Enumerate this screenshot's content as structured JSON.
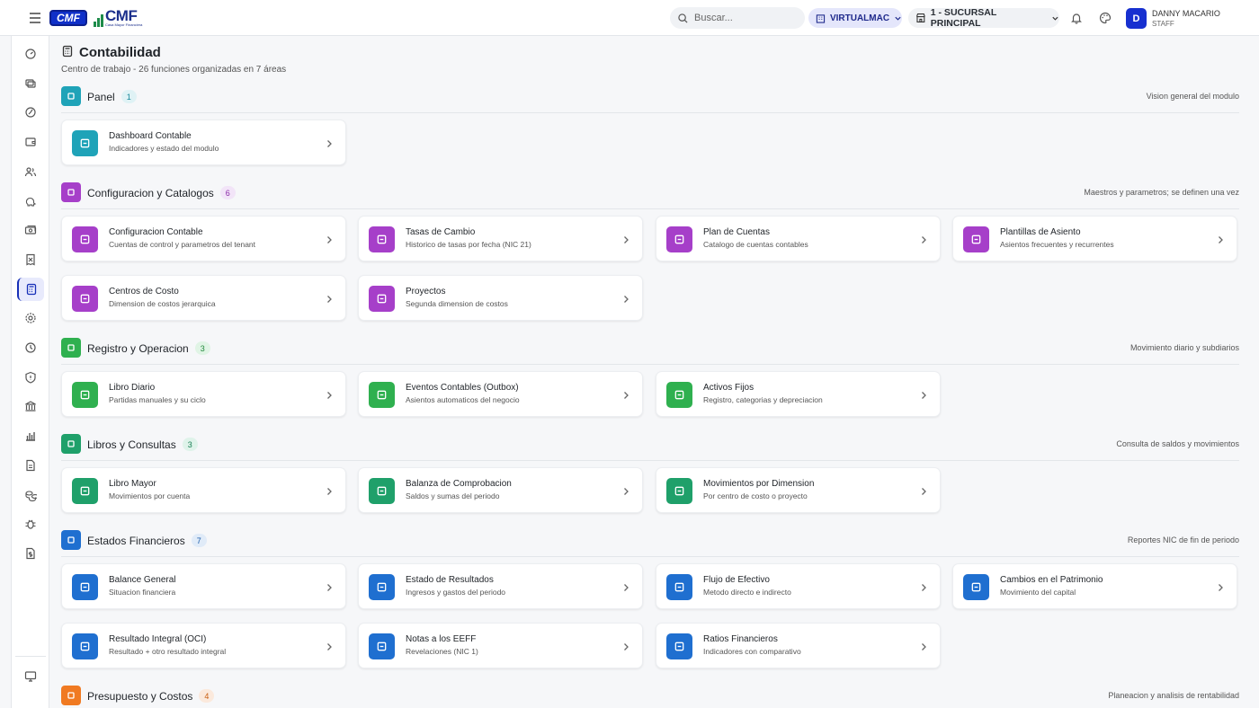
{
  "header": {
    "logo_badge": "CMF",
    "logo_word": "CMF",
    "logo_small": "Casa Mayor Financiera",
    "search_placeholder": "Buscar...",
    "tenant": "VIRTUALMAC",
    "branch": "1 - SUCURSAL PRINCIPAL",
    "user_initial": "D",
    "user_name": "DANNY MACARIO",
    "user_role": "STAFF"
  },
  "sidebar": {
    "items": [
      "dashboard-icon",
      "exchange-icon",
      "gauge-icon",
      "wallet-icon",
      "users-icon",
      "piggy-bank-icon",
      "money-icon",
      "invoice-icon",
      "calculator-icon",
      "settings-icon",
      "history-icon",
      "shield-icon",
      "bank-icon",
      "bar-chart-icon",
      "document-icon",
      "coins-icon",
      "bug-icon",
      "file-dollar-icon"
    ],
    "active_index": 8,
    "footer_icon": "screen-settings-icon"
  },
  "page": {
    "title": "Contabilidad",
    "subtitle": "Centro de trabajo - 26 funciones organizadas en 7 áreas"
  },
  "sections": [
    {
      "title": "Panel",
      "count": "1",
      "desc": "Vision general del modulo",
      "color": "#1fa3b8",
      "badge_bg": "#dff2f5",
      "badge_fg": "#17879a",
      "cards": [
        {
          "title": "Dashboard Contable",
          "sub": "Indicadores y estado del modulo"
        }
      ]
    },
    {
      "title": "Configuracion y Catalogos",
      "count": "6",
      "desc": "Maestros y parametros; se definen una vez",
      "color": "#a63fc9",
      "badge_bg": "#f2e4f8",
      "badge_fg": "#8a2aa8",
      "cards": [
        {
          "title": "Configuracion Contable",
          "sub": "Cuentas de control y parametros del tenant"
        },
        {
          "title": "Tasas de Cambio",
          "sub": "Historico de tasas por fecha (NIC 21)"
        },
        {
          "title": "Plan de Cuentas",
          "sub": "Catalogo de cuentas contables"
        },
        {
          "title": "Plantillas de Asiento",
          "sub": "Asientos frecuentes y recurrentes"
        },
        {
          "title": "Centros de Costo",
          "sub": "Dimension de costos jerarquica"
        },
        {
          "title": "Proyectos",
          "sub": "Segunda dimension de costos"
        }
      ]
    },
    {
      "title": "Registro y Operacion",
      "count": "3",
      "desc": "Movimiento diario y subdiarios",
      "color": "#2fb04f",
      "badge_bg": "#e0f4e5",
      "badge_fg": "#22883c",
      "cards": [
        {
          "title": "Libro Diario",
          "sub": "Partidas manuales y su ciclo"
        },
        {
          "title": "Eventos Contables (Outbox)",
          "sub": "Asientos automaticos del negocio"
        },
        {
          "title": "Activos Fijos",
          "sub": "Registro, categorias y depreciacion"
        }
      ]
    },
    {
      "title": "Libros y Consultas",
      "count": "3",
      "desc": "Consulta de saldos y movimientos",
      "color": "#1fa06a",
      "badge_bg": "#dff3ea",
      "badge_fg": "#187f54",
      "cards": [
        {
          "title": "Libro Mayor",
          "sub": "Movimientos por cuenta"
        },
        {
          "title": "Balanza de Comprobacion",
          "sub": "Saldos y sumas del periodo"
        },
        {
          "title": "Movimientos por Dimension",
          "sub": "Por centro de costo o proyecto"
        }
      ]
    },
    {
      "title": "Estados Financieros",
      "count": "7",
      "desc": "Reportes NIC de fin de periodo",
      "color": "#1f6fd0",
      "badge_bg": "#e0ebf8",
      "badge_fg": "#1a5aa8",
      "cards": [
        {
          "title": "Balance General",
          "sub": "Situacion financiera"
        },
        {
          "title": "Estado de Resultados",
          "sub": "Ingresos y gastos del periodo"
        },
        {
          "title": "Flujo de Efectivo",
          "sub": "Metodo directo e indirecto"
        },
        {
          "title": "Cambios en el Patrimonio",
          "sub": "Movimiento del capital"
        },
        {
          "title": "Resultado Integral (OCI)",
          "sub": "Resultado + otro resultado integral"
        },
        {
          "title": "Notas a los EEFF",
          "sub": "Revelaciones (NIC 1)"
        },
        {
          "title": "Ratios Financieros",
          "sub": "Indicadores con comparativo"
        }
      ]
    },
    {
      "title": "Presupuesto y Costos",
      "count": "4",
      "desc": "Planeacion y analisis de rentabilidad",
      "color": "#f07a22",
      "badge_bg": "#fbe9dc",
      "badge_fg": "#c85f12",
      "cards": []
    }
  ]
}
